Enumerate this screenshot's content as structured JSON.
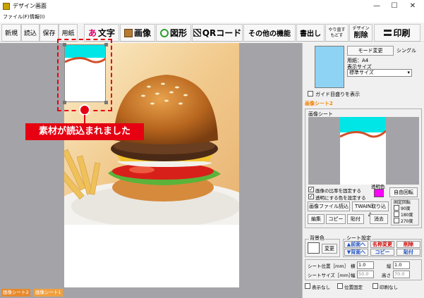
{
  "window": {
    "title": "デザイン画面",
    "controls": [
      "—",
      "☐",
      "✕"
    ]
  },
  "menu": [
    "ファイル(F)",
    "情報(I)"
  ],
  "toolbar": {
    "new": "新規",
    "load": "読込",
    "save": "保存",
    "paper": "用紙",
    "text_icon": "あ",
    "text": "文字",
    "image": "画像",
    "shape": "図形",
    "qr": "QRコード",
    "other": "その他の機能",
    "write": "書出し",
    "redo": "やり直す",
    "undo": "もどす",
    "design_small": "デザイン",
    "delete": "削除",
    "print": "印刷"
  },
  "canvas": {
    "callout": "素材が読込まれました"
  },
  "bottom_tabs": [
    "画像シート2",
    "画像シート1"
  ],
  "right": {
    "mode_change": "モード変更",
    "single": "シングル",
    "paper_label": "用紙：A4",
    "display_size_label": "表示サイズ",
    "display_size_value": "標準サイズ",
    "guide_label": "ガイド目盛りを表示",
    "sheet_tab": "画像シート2",
    "sheet_title": "画像シート",
    "fix_ratio": "画像の比率を固定する",
    "transparent_color": "透明にする色を設定する",
    "transparent_label": "透明色",
    "free_rotate": "自由回転",
    "image_file_load": "画像ファイル読込",
    "twain": "TWAIN取り込み",
    "edit": "編集",
    "copy": "コピー",
    "paste": "貼付",
    "erase": "消去",
    "rotate_title": "固定回転",
    "rot90": "90度",
    "rot180": "180度",
    "rot270": "270度",
    "bg_color": "背景色",
    "change": "変更",
    "sheet_settings": "シート設定",
    "to_front": "▲前面へ",
    "to_back": "▼背面へ",
    "rename": "名称変更",
    "copy2": "コピー",
    "delete2": "削除",
    "paste2": "貼付",
    "sheet_pos": "シート位置［mm］",
    "horiz": "横",
    "horiz_val": "1.0",
    "vert": "縦",
    "vert_val": "1.0",
    "sheet_size": "シートサイズ［mm］",
    "width": "幅",
    "width_val": "50.0",
    "height": "高さ",
    "height_val": "70.0",
    "hide": "表示なし",
    "pos_fix": "位置固定",
    "no_print": "印刷なし"
  }
}
